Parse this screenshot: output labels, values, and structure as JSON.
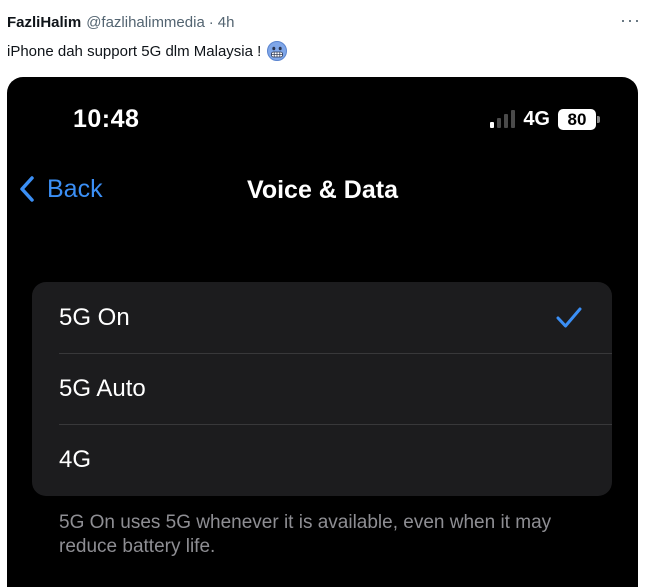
{
  "tweet": {
    "author_name": "FazliHalim",
    "author_handle": "@fazlihalimmedia",
    "separator": "·",
    "time": "4h",
    "more_label": "···",
    "text": "iPhone dah support 5G dlm Malaysia !",
    "emoji_icon": "grimacing-face-icon"
  },
  "phone": {
    "status_bar": {
      "time": "10:48",
      "network": "4G",
      "battery": "80",
      "signal_bars_on": 1,
      "signal_bars_total": 4
    },
    "nav": {
      "back_label": "Back",
      "title": "Voice & Data"
    },
    "options": [
      {
        "label": "5G On",
        "selected": true
      },
      {
        "label": "5G Auto",
        "selected": false
      },
      {
        "label": "4G",
        "selected": false
      }
    ],
    "footer_note": "5G On uses 5G whenever it is available, even when it may reduce battery life."
  },
  "colors": {
    "ios_blue": "#3b8ff5",
    "cell_bg": "#1c1c1e"
  }
}
